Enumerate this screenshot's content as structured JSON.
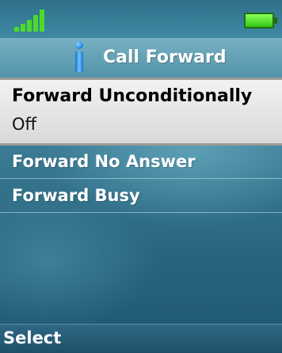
{
  "status": {
    "signal_icon": "signal-strength-icon",
    "battery_icon": "battery-full-icon",
    "signal_color": "#4bdc27",
    "battery_color": "#32c812"
  },
  "header": {
    "icon": "info-icon",
    "title": "Call Forward"
  },
  "menu": {
    "items": [
      {
        "label": "Forward Unconditionally",
        "value": "Off"
      },
      {
        "label": "Forward No Answer"
      },
      {
        "label": "Forward Busy"
      }
    ]
  },
  "softkeys": {
    "left": "Select"
  },
  "colors": {
    "selection_background": "#e6e6e6",
    "text_on_background": "#ffffff"
  }
}
